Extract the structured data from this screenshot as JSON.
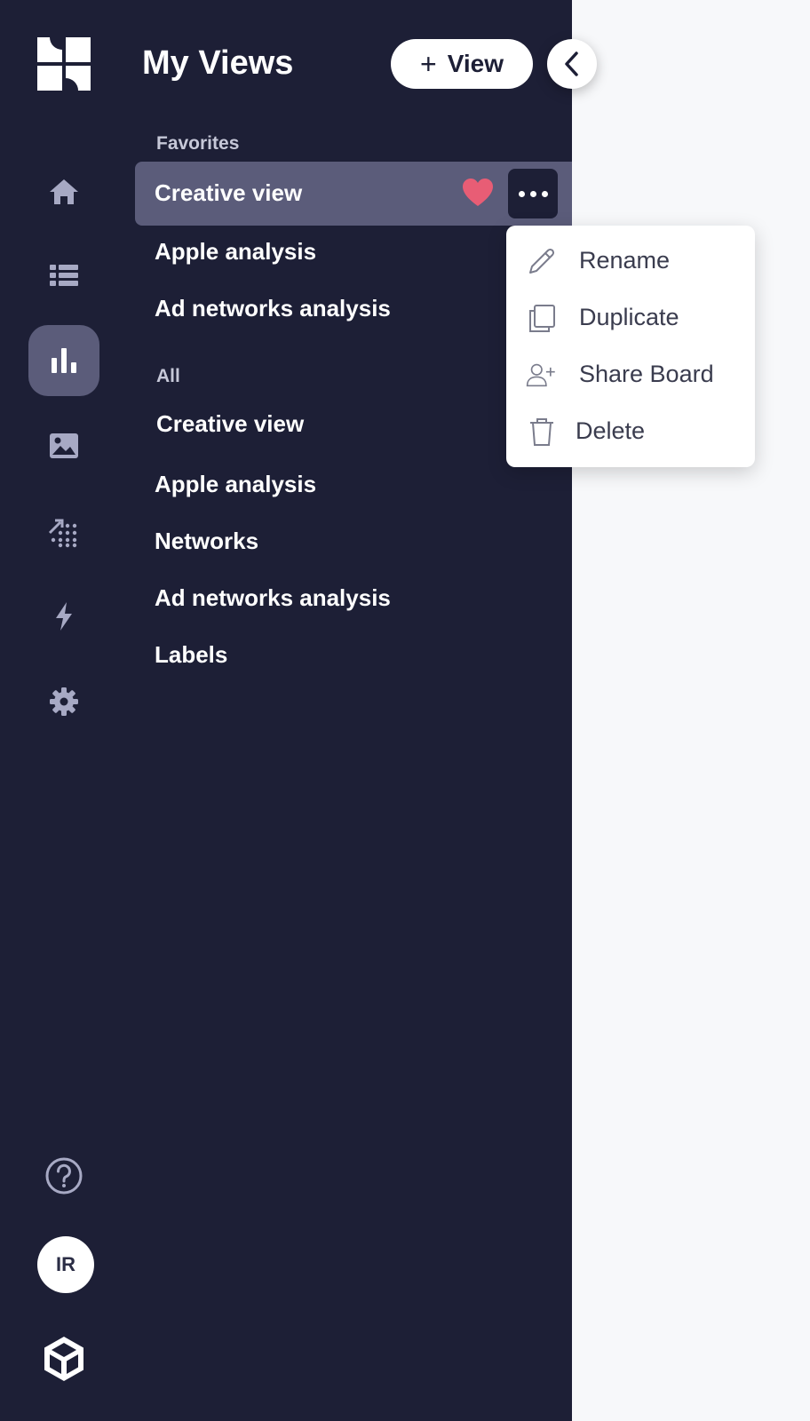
{
  "app": {
    "title": "My Views",
    "add_view_label": "View",
    "collapse_icon": "chevron-left-icon"
  },
  "rail": {
    "items": [
      {
        "name": "home",
        "icon": "home-icon",
        "active": false
      },
      {
        "name": "list",
        "icon": "list-icon",
        "active": false
      },
      {
        "name": "analytics",
        "icon": "bar-chart-icon",
        "active": true
      },
      {
        "name": "creatives",
        "icon": "image-icon",
        "active": false
      },
      {
        "name": "trends",
        "icon": "trend-dots-icon",
        "active": false
      },
      {
        "name": "automation",
        "icon": "lightning-icon",
        "active": false
      },
      {
        "name": "settings",
        "icon": "gear-icon",
        "active": false
      }
    ],
    "help_icon": "help-icon",
    "avatar_initials": "IR",
    "footer_logo": "unity-logo"
  },
  "favorites": {
    "heading": "Favorites",
    "items": [
      "Creative view",
      "Apple analysis",
      "Ad networks analysis"
    ],
    "selected_favorite_icon": "heart-icon"
  },
  "all": {
    "heading": "All",
    "items": [
      "Creative view",
      "Apple analysis",
      "Networks",
      "Ad networks analysis",
      "Labels"
    ]
  },
  "context_menu": {
    "items": [
      {
        "label": "Rename",
        "icon": "pencil-icon"
      },
      {
        "label": "Duplicate",
        "icon": "duplicate-icon"
      },
      {
        "label": "Share Board",
        "icon": "add-user-icon"
      },
      {
        "label": "Delete",
        "icon": "trash-icon"
      }
    ]
  },
  "colors": {
    "sidebar_bg": "#1d1f36",
    "active_bg": "#5b5c7a",
    "heart": "#e85d75",
    "content_bg": "#f7f8fa"
  }
}
